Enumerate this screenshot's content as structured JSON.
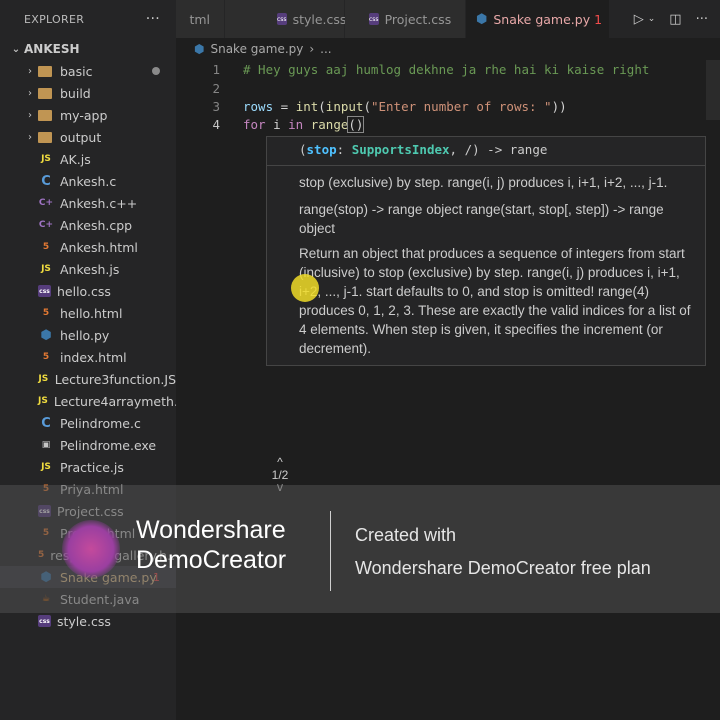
{
  "sidebar": {
    "title": "EXPLORER",
    "folder": "ANKESH",
    "folders": [
      "basic",
      "build",
      "my-app",
      "output"
    ],
    "files": [
      {
        "name": "AK.js",
        "icon": "JS"
      },
      {
        "name": "Ankesh.c",
        "icon": "C"
      },
      {
        "name": "Ankesh.c++",
        "icon": "C++"
      },
      {
        "name": "Ankesh.cpp",
        "icon": "C++"
      },
      {
        "name": "Ankesh.html",
        "icon": "5"
      },
      {
        "name": "Ankesh.js",
        "icon": "JS"
      },
      {
        "name": "hello.css",
        "icon": "css"
      },
      {
        "name": "hello.html",
        "icon": "5"
      },
      {
        "name": "hello.py",
        "icon": "py"
      },
      {
        "name": "index.html",
        "icon": "5"
      },
      {
        "name": "Lecture3function.JS",
        "icon": "JS"
      },
      {
        "name": "Lecture4arraymeth...",
        "icon": "JS"
      },
      {
        "name": "Pelindrome.c",
        "icon": "C"
      },
      {
        "name": "Pelindrome.exe",
        "icon": "exe"
      },
      {
        "name": "Practice.js",
        "icon": "JS"
      },
      {
        "name": "Priya.html",
        "icon": "5"
      },
      {
        "name": "Project.css",
        "icon": "css"
      },
      {
        "name": "Project.html",
        "icon": "5"
      },
      {
        "name": "responsiv gallery.h...",
        "icon": "5"
      },
      {
        "name": "Snake game.py",
        "icon": "py",
        "badge": "1"
      },
      {
        "name": "Student.java",
        "icon": "java"
      },
      {
        "name": "style.css",
        "icon": "css"
      }
    ]
  },
  "tabs": [
    {
      "label": "tml"
    },
    {
      "label": "style.css"
    },
    {
      "label": "Project.css"
    },
    {
      "label": "Snake game.py",
      "badge": "1"
    }
  ],
  "breadcrumb": {
    "file": "Snake game.py",
    "rest": "..."
  },
  "editor": {
    "lines": [
      {
        "n": "1",
        "comment": "# Hey guys aaj humlog dekhne ja rhe hai ki kaise right"
      },
      {
        "n": "2"
      },
      {
        "n": "3",
        "var": "rows",
        "eq": " = ",
        "fn1": "int",
        "p1": "(",
        "fn2": "input",
        "p2": "(",
        "str": "\"Enter number of rows: \"",
        "p3": "))"
      },
      {
        "n": "4",
        "kw1": "for",
        "sp1": " i ",
        "kw2": "in",
        "sp2": " ",
        "fn": "range",
        "p": "()"
      }
    ]
  },
  "hover": {
    "sig_open": "(",
    "sig_param": "stop",
    "sig_colon": ": ",
    "sig_type": "SupportsIndex",
    "sig_rest": ", /) -> range",
    "p1": "stop (exclusive) by step. range(i, j) produces i, i+1, i+2, ..., j-1.",
    "p2": "range(stop) -> range object range(start, stop[, step]) -> range object",
    "p3": "Return an object that produces a sequence of integers from start (inclusive) to stop (exclusive) by step. range(i, j) produces i, i+1, i+2, ..., j-1. start defaults to 0, and stop is omitted! range(4) produces 0, 1, 2, 3. These are exactly the valid indices for a list of 4 elements. When step is given, it specifies the increment (or decrement).",
    "up": "^",
    "page": "1/2",
    "down": "v"
  },
  "watermark": {
    "brand_line1": "Wondershare",
    "brand_line2": "DemoCreator",
    "created_line1": "Created with",
    "created_line2": "Wondershare DemoCreator free plan"
  }
}
